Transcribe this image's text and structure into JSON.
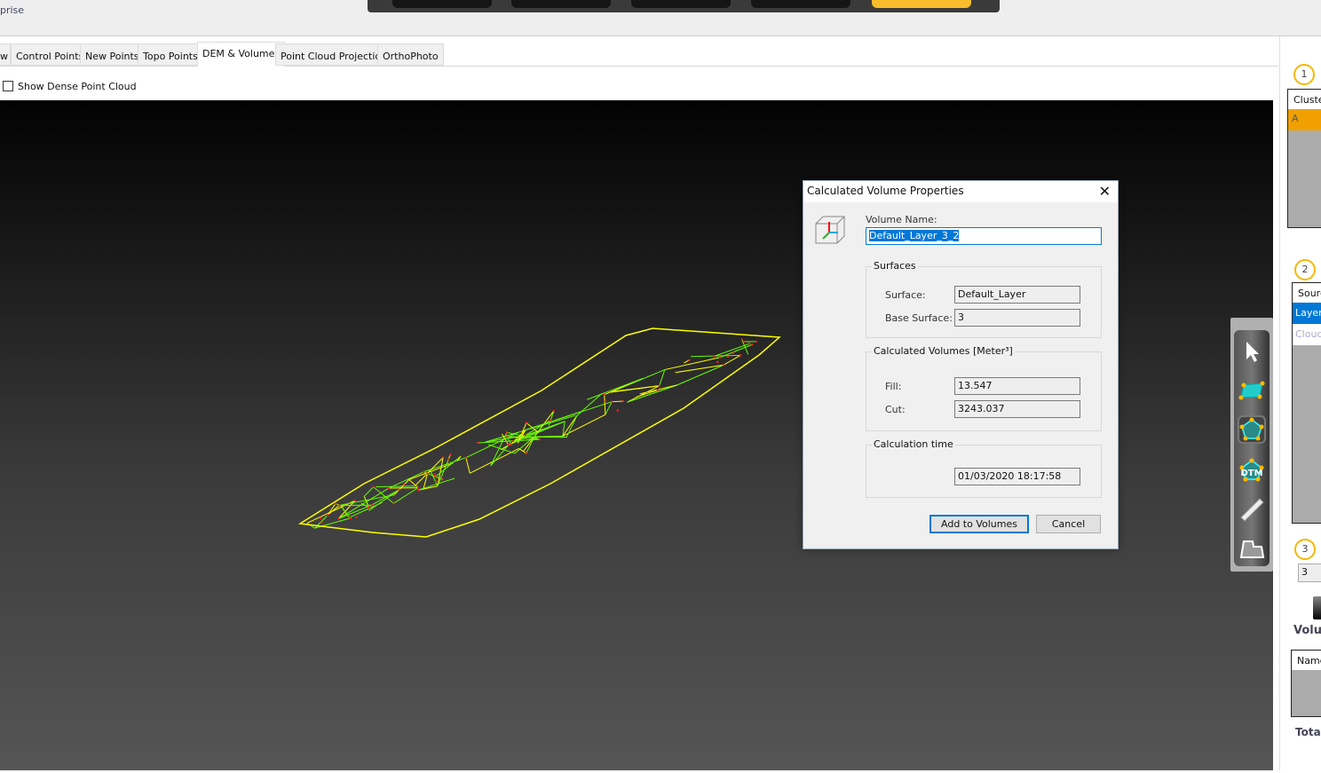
{
  "app": {
    "brand_fragment": "prise"
  },
  "tabs": [
    {
      "label": "w"
    },
    {
      "label": "Control Points"
    },
    {
      "label": "New Points"
    },
    {
      "label": "Topo Points"
    },
    {
      "label": "DEM & Volumes",
      "active": true
    },
    {
      "label": "Point Cloud Projection"
    },
    {
      "label": "OrthoPhoto"
    }
  ],
  "options": {
    "show_dense_point_cloud": {
      "label": "Show Dense Point Cloud",
      "checked": false
    }
  },
  "colors": {
    "accent": "#f5b800",
    "selection": "#0078d7",
    "mesh_edge": "#ffff00",
    "mesh_interior": "#66ff00",
    "points": "#ff2222"
  },
  "right_panel": {
    "step1": "1",
    "cluster_header": "Cluste",
    "cluster_row": "A",
    "step2": "2",
    "source_header": "Sourc",
    "source_rows": [
      "Layer",
      "Cloud"
    ],
    "step3": "3",
    "step3_value": "3",
    "volumes_heading": "Volu",
    "name_header": "Name",
    "total_label": "Total"
  },
  "tools": [
    "pointer-icon",
    "mesh-surface-icon",
    "polygon-volume-icon",
    "dtm-icon",
    "ruler-icon",
    "area-profile-icon"
  ],
  "tool_dtm_label": "DTM",
  "dialog": {
    "title": "Calculated Volume Properties",
    "volume_name_label": "Volume Name:",
    "volume_name": "Default_Layer_3_2",
    "surfaces_group": "Surfaces",
    "surface_label": "Surface:",
    "surface": "Default_Layer",
    "base_surface_label": "Base Surface:",
    "base_surface": "3",
    "volumes_group": "Calculated Volumes [Meter³]",
    "fill_label": "Fill:",
    "fill": "13.547",
    "cut_label": "Cut:",
    "cut": "3243.037",
    "time_group": "Calculation time",
    "time": "01/03/2020 18:17:58",
    "add_button": "Add to Volumes",
    "cancel_button": "Cancel"
  }
}
